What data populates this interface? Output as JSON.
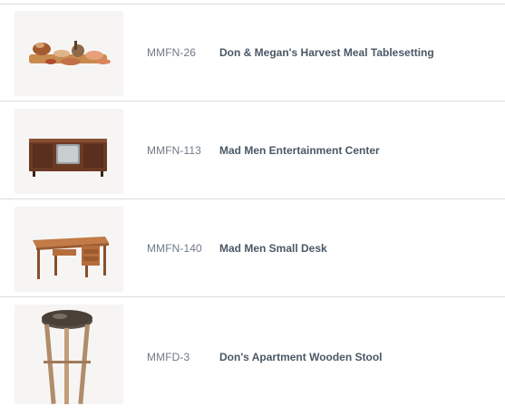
{
  "products": [
    {
      "sku": "MMFN-26",
      "name": "Don & Megan's Harvest Meal Tablesetting",
      "thumbnail_icon": "tablesetting-thumbnail"
    },
    {
      "sku": "MMFN-113",
      "name": "Mad Men Entertainment Center",
      "thumbnail_icon": "entertainment-center-thumbnail"
    },
    {
      "sku": "MMFN-140",
      "name": "Mad Men Small Desk",
      "thumbnail_icon": "small-desk-thumbnail"
    },
    {
      "sku": "MMFD-3",
      "name": "Don's Apartment Wooden Stool",
      "thumbnail_icon": "wooden-stool-thumbnail"
    }
  ]
}
